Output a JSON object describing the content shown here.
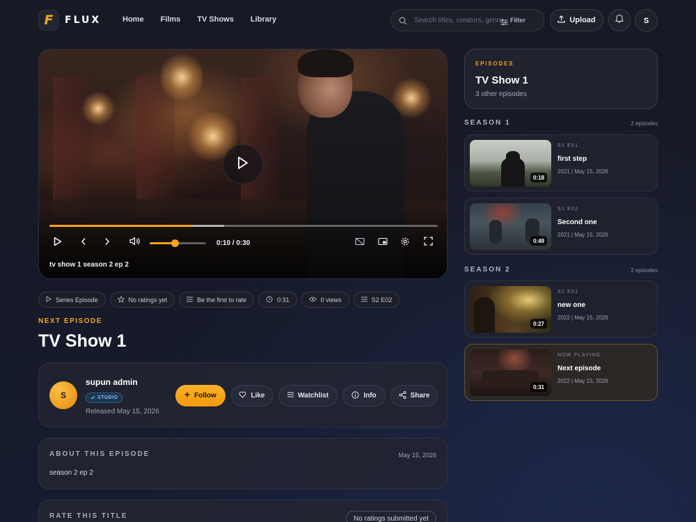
{
  "app": {
    "logo_letter": "F",
    "logo_text": "FLUX"
  },
  "nav": {
    "items": [
      {
        "label": "Home"
      },
      {
        "label": "Films"
      },
      {
        "label": "TV Shows"
      },
      {
        "label": "Library"
      }
    ]
  },
  "search": {
    "placeholder": "Search titles, creators, genre",
    "filter_label": "Filter"
  },
  "header": {
    "upload_label": "Upload",
    "user_initial": "S"
  },
  "player": {
    "current_time": "0:10",
    "total_time": "0:30",
    "time_display": "0:10 / 0:30",
    "progress_fraction": 0.367,
    "volume_fraction": 0.45,
    "caption": "tv show 1 season 2 ep 2"
  },
  "pills": [
    {
      "icon": "play-icon",
      "label": "Series Episode"
    },
    {
      "icon": "star-icon",
      "label": "No ratings yet"
    },
    {
      "icon": "list-icon",
      "label": "Be the first to rate"
    },
    {
      "icon": "clock-icon",
      "label": "0:31"
    },
    {
      "icon": "eye-icon",
      "label": "0 views"
    },
    {
      "icon": "list-icon",
      "label": "S2 E02"
    }
  ],
  "main": {
    "next_label": "NEXT EPISODE",
    "title": "TV Show 1"
  },
  "creator": {
    "initial": "S",
    "name": "supun admin",
    "badge": "STUDIO",
    "released": "Released May 15, 2026",
    "actions": {
      "follow": "Follow",
      "like": "Like",
      "watchlist": "Watchlist",
      "info": "Info",
      "share": "Share"
    }
  },
  "about": {
    "heading": "ABOUT THIS EPISODE",
    "date": "May 15, 2026",
    "text": "season 2 ep 2"
  },
  "rate": {
    "heading": "RATE THIS TITLE",
    "badge": "No ratings submitted yet"
  },
  "sidebar": {
    "kicker": "EPISODES",
    "title": "TV Show 1",
    "subtitle": "3 other episodes",
    "seasons": [
      {
        "label": "SEASON 1",
        "count": "2 episodes",
        "episodes": [
          {
            "code": "S1 E01",
            "name": "first step",
            "meta": "2021  |  May 15, 2026",
            "duration": "0:18"
          },
          {
            "code": "S1 E02",
            "name": "Second one",
            "meta": "2021  |  May 15, 2026",
            "duration": "0:49"
          }
        ]
      },
      {
        "label": "SEASON 2",
        "count": "2 episodes",
        "episodes": [
          {
            "code": "S2 E01",
            "name": "new one",
            "meta": "2022  |  May 15, 2026",
            "duration": "0:27"
          },
          {
            "code": "NOW PLAYING",
            "name": "Next episode",
            "meta": "2022  |  May 15, 2026",
            "duration": "0:31"
          }
        ]
      }
    ]
  },
  "colors": {
    "accent": "#f7a51a",
    "background": "#171a24",
    "card": "#222430"
  }
}
